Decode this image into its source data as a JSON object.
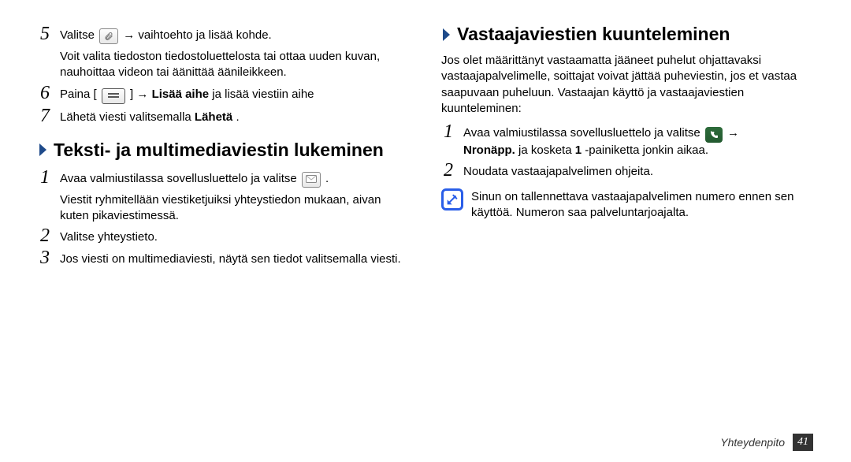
{
  "left": {
    "step5": {
      "num": "5",
      "line1_a": "Valitse ",
      "line1_b": " → vaihtoehto ja lisää kohde.",
      "para": "Voit valita tiedoston tiedostoluettelosta tai ottaa uuden kuvan, nauhoittaa videon tai äänittää äänileikkeen."
    },
    "step6": {
      "num": "6",
      "text_a": "Paina [",
      "text_b": "] → ",
      "bold": "Lisää aihe",
      "text_c": " ja lisää viestiin aihe"
    },
    "step7": {
      "num": "7",
      "text_a": "Lähetä viesti valitsemalla ",
      "bold": "Lähetä",
      "text_b": "."
    },
    "section_title": "Teksti- ja multimediaviestin lukeminen",
    "sub1": {
      "num": "1",
      "text_a": "Avaa valmiustilassa sovellusluettelo ja valitse ",
      "text_b": ".",
      "para": "Viestit ryhmitellään viestiketjuiksi yhteystiedon mukaan, aivan kuten pikaviestimessä."
    },
    "sub2": {
      "num": "2",
      "text": "Valitse yhteystieto."
    },
    "sub3": {
      "num": "3",
      "text": "Jos viesti on multimediaviesti, näytä sen tiedot valitsemalla viesti."
    }
  },
  "right": {
    "section_title": "Vastaajaviestien kuunteleminen",
    "intro": "Jos olet määrittänyt vastaamatta jääneet puhelut ohjattavaksi vastaajapalvelimelle, soittajat voivat jättää puheviestin, jos et vastaa saapuvaan puheluun. Vastaajan käyttö ja vastaajaviestien kuunteleminen:",
    "step1": {
      "num": "1",
      "text_a": "Avaa valmiustilassa sovellusluettelo ja valitse ",
      "text_b": " →",
      "bold": "Nronäpp.",
      "text_c": " ja kosketa ",
      "bold2": "1",
      "text_d": "-painiketta jonkin aikaa."
    },
    "step2": {
      "num": "2",
      "text": "Noudata vastaajapalvelimen ohjeita."
    },
    "note": "Sinun on tallennettava vastaajapalvelimen numero ennen sen käyttöä. Numeron saa palveluntarjoajalta."
  },
  "footer": {
    "title": "Yhteydenpito",
    "page": "41"
  },
  "icons": {
    "attach": "attach-icon",
    "menu": "menu-key-icon",
    "message": "message-icon",
    "phone": "phone-icon",
    "note": "note-icon",
    "chevron": "chevron-right-icon"
  }
}
